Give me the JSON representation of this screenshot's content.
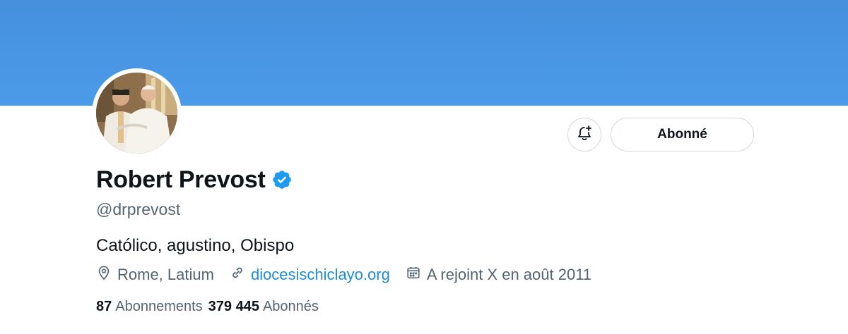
{
  "profile": {
    "name": "Robert Prevost",
    "handle": "@drprevost",
    "bio": "Católico, agustino, Obispo",
    "location": "Rome, Latium",
    "website": "diocesischiclayo.org",
    "joined": "A rejoint X en août 2011"
  },
  "actions": {
    "follow_label": "Abonné",
    "notifications_icon": "bell-plus-icon"
  },
  "stats": {
    "following_count": "87",
    "following_label": "Abonnements",
    "followers_count": "379 445",
    "followers_label": "Abonnés"
  },
  "colors": {
    "banner": "#4a9be9",
    "verified": "#1d9bf0",
    "link": "#1d8bd8",
    "secondary_text": "#536471"
  }
}
